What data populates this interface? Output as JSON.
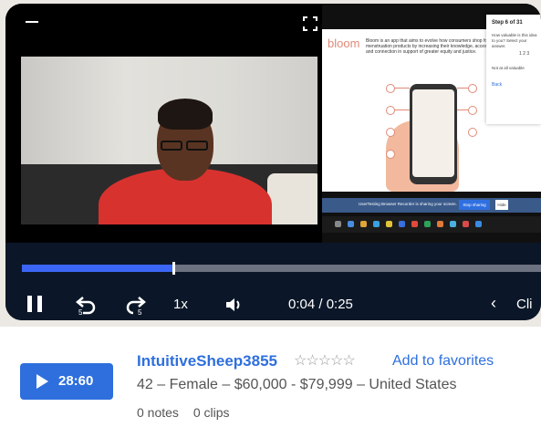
{
  "player": {
    "step_card": {
      "title": "Step 6 of 31",
      "question": "How valuable is this idea to you? Select your answer.",
      "scale": "1 2 3",
      "not_valuable": "Not at all valuable",
      "back": "Back"
    },
    "slide": {
      "logo": "bloom",
      "intro": "Bloom is an app that aims to evolve how consumers shop for menstruation products by increasing their knowledge, access, and connection in support of greater equity and justice."
    },
    "share_bar": {
      "text": "UserTesting Browser Recorder is sharing your screen.",
      "stop": "Stop sharing",
      "hide": "Hide"
    },
    "controls": {
      "rate": "1x",
      "time": "0:04 / 0:25",
      "clips_partial": "Cli",
      "progress": 0.29
    }
  },
  "session": {
    "play_duration": "28:60",
    "username": "IntuitiveSheep3855",
    "stars": "☆☆☆☆☆",
    "add_favorites": "Add to favorites",
    "demographics": "42 – Female – $60,000 - $79,999 – United States",
    "notes": "0 notes",
    "clips": "0 clips"
  },
  "colors": {
    "accent": "#2e6fdd",
    "progress": "#3b66f5",
    "player_bg": "#0b1728"
  }
}
